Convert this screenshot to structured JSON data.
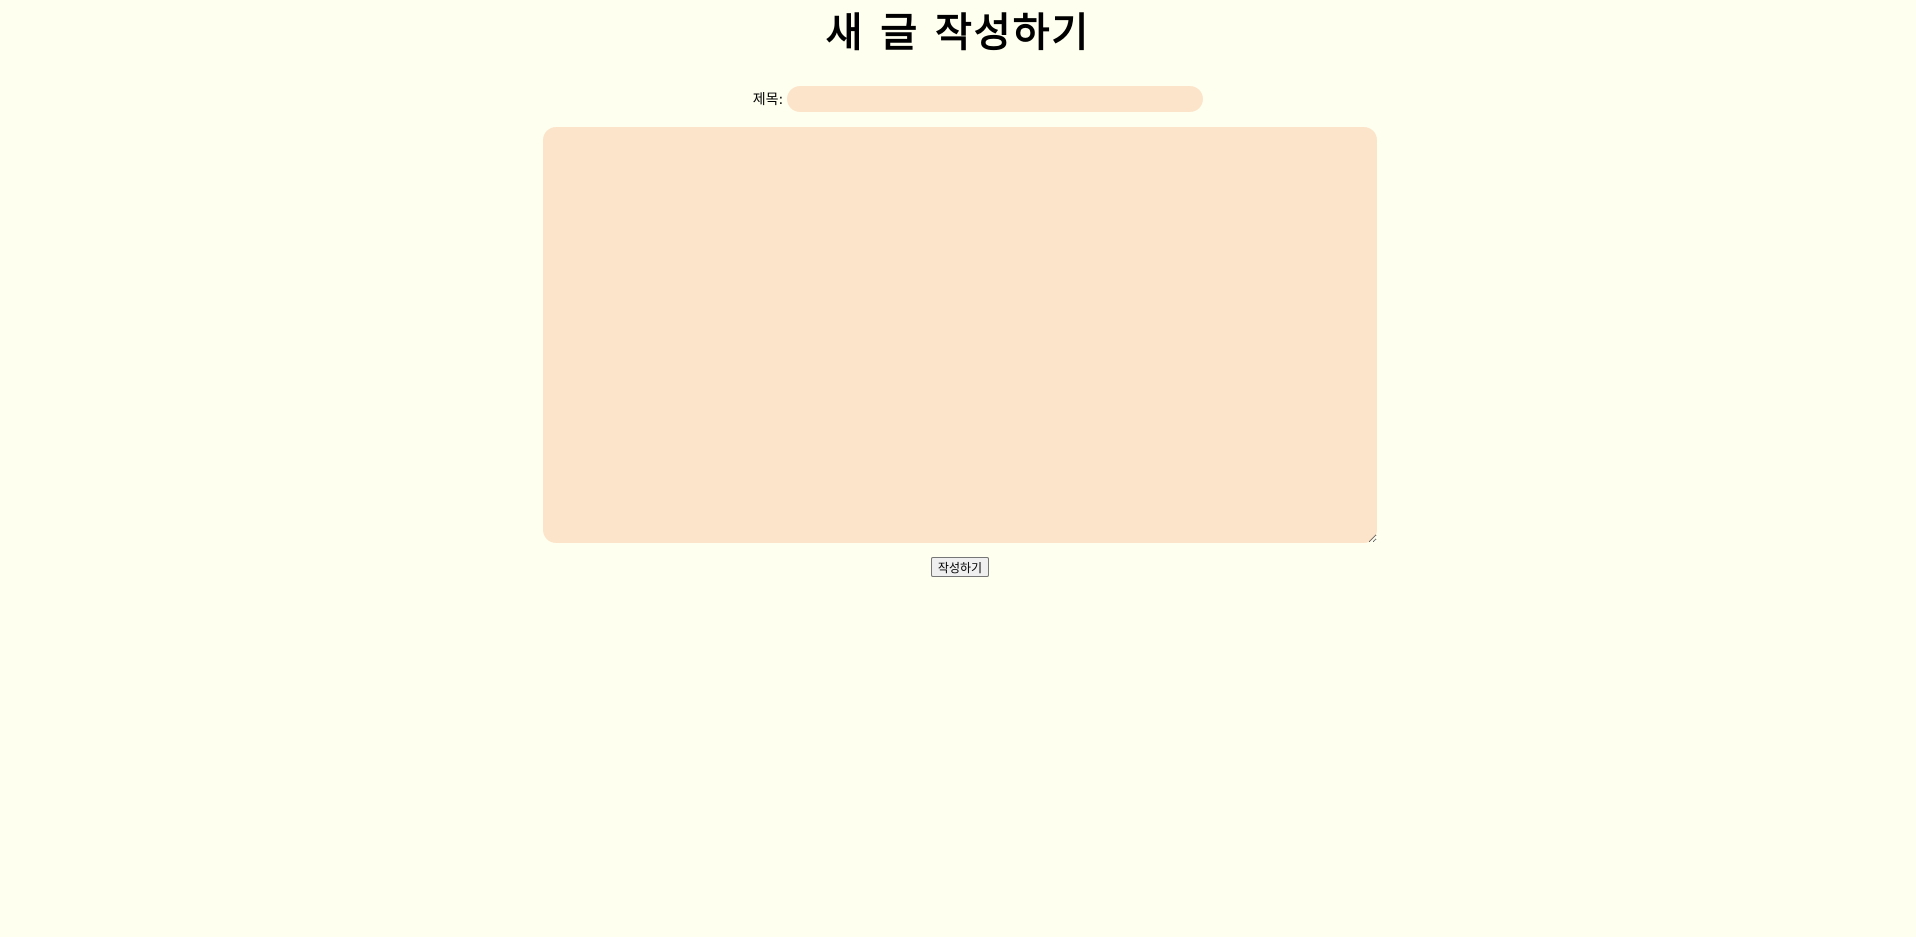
{
  "header": {
    "title": "새 글 작성하기"
  },
  "form": {
    "title_label": "제목:",
    "title_value": "",
    "content_value": "",
    "submit_label": "작성하기"
  },
  "colors": {
    "background": "#fffff0",
    "field_background": "#fbe4c9"
  }
}
